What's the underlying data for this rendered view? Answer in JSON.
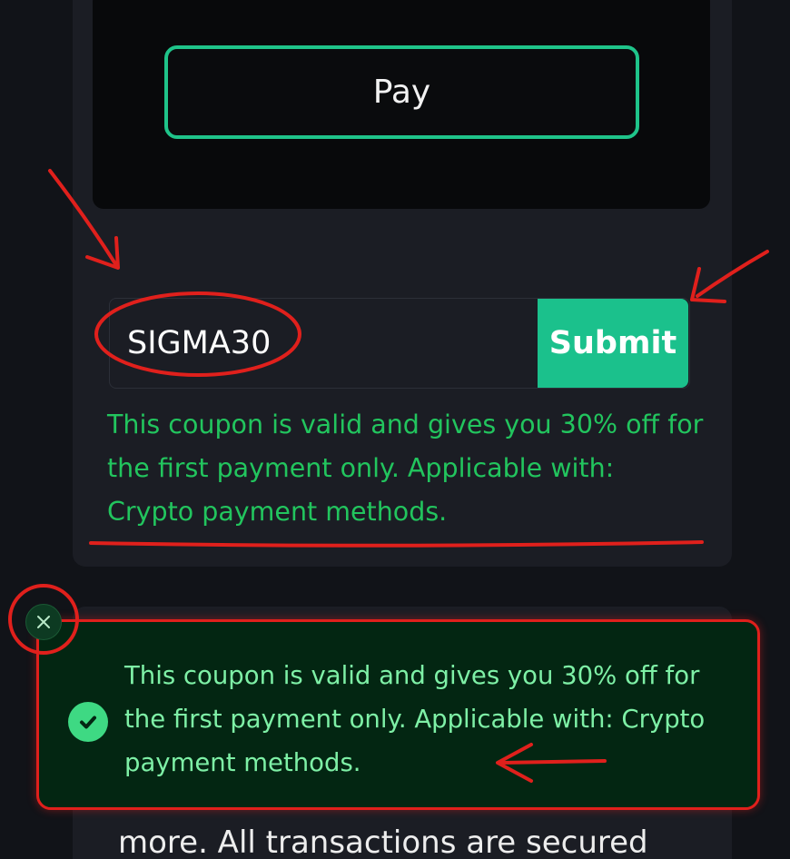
{
  "pay": {
    "label": "Pay"
  },
  "coupon": {
    "value": "SIGMA30",
    "submit_label": "Submit",
    "message": "This coupon is valid and gives you 30% off for the first payment only. Applicable with: Crypto payment methods."
  },
  "toast": {
    "message": "This coupon is valid and gives you 30% off for the first payment only. Applicable with: Crypto payment methods.",
    "icon": "check-circle-icon",
    "close_icon": "close-icon"
  },
  "background_text": "more. All transactions are secured",
  "colors": {
    "accent": "#1bc18c",
    "success_text": "#22c55e",
    "toast_bg": "#032612",
    "annotation": "#e0201c"
  }
}
